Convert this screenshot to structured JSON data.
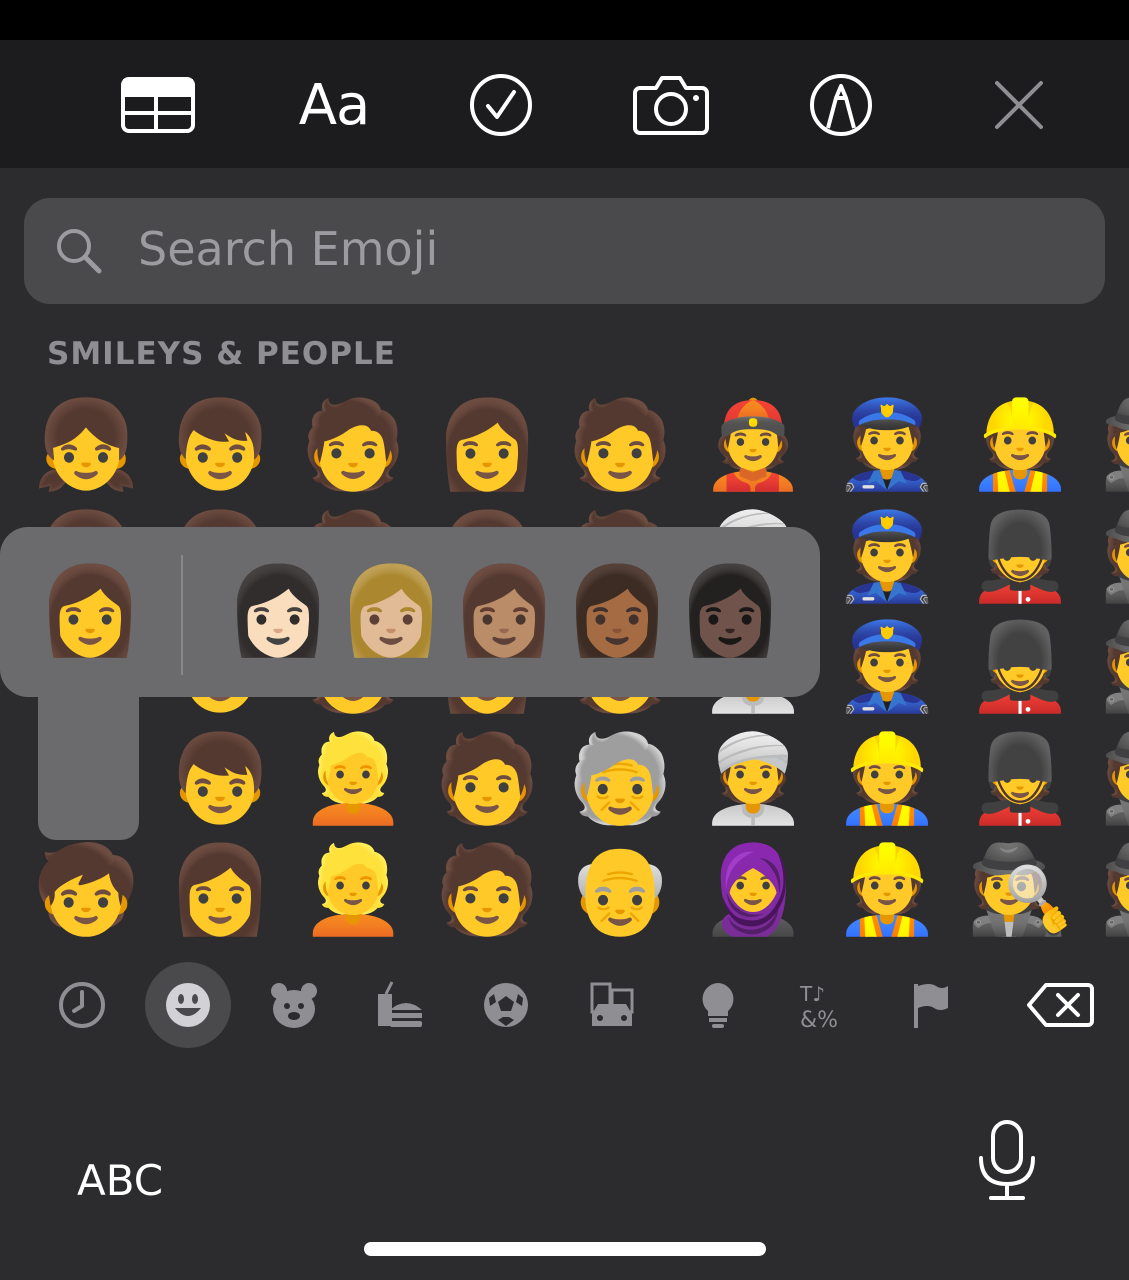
{
  "toolbar": {
    "items": [
      {
        "name": "table-icon"
      },
      {
        "name": "text-format-button",
        "label": "Aa"
      },
      {
        "name": "checklist-icon"
      },
      {
        "name": "camera-icon"
      },
      {
        "name": "markup-pen-icon"
      },
      {
        "name": "close-icon"
      }
    ]
  },
  "search": {
    "placeholder": "Search Emoji"
  },
  "section": {
    "title": "SMILEYS & PEOPLE"
  },
  "grid": {
    "rows": [
      [
        "👧",
        "👦",
        "🧑",
        "👩",
        "🧑",
        "👲",
        "👮",
        "👷",
        "🕵"
      ],
      [
        "👧",
        "👦",
        "🧑",
        "👩",
        "🧑",
        "👳",
        "👮",
        "💂",
        "🕵"
      ],
      [
        "👧",
        "👦",
        "🧑",
        "👩",
        "🧑",
        "👳",
        "👮",
        "💂",
        "🕵"
      ],
      [
        "",
        "👦",
        "👱",
        "🧑",
        "🧓",
        "👳",
        "👷",
        "💂",
        "🕵"
      ],
      [
        "🧒",
        "👩",
        "👱",
        "🧑",
        "👴",
        "🧕",
        "👷",
        "🕵",
        "🕵"
      ]
    ]
  },
  "popup": {
    "base": "👩",
    "variants": [
      "👩🏻",
      "👩🏼",
      "👩🏽",
      "👩🏾",
      "👩🏿"
    ]
  },
  "categories": [
    {
      "name": "recent-icon"
    },
    {
      "name": "smileys-icon",
      "selected": true
    },
    {
      "name": "animals-icon"
    },
    {
      "name": "food-icon"
    },
    {
      "name": "activity-icon"
    },
    {
      "name": "travel-icon"
    },
    {
      "name": "objects-icon"
    },
    {
      "name": "symbols-icon"
    },
    {
      "name": "flags-icon"
    },
    {
      "name": "delete-icon"
    }
  ],
  "bottom": {
    "abc_label": "ABC"
  },
  "colors": {
    "toolbar_bg": "#1c1c1e",
    "keyboard_bg": "#2c2c2e",
    "search_bg": "#4a4a4c",
    "popup_bg": "#6b6b6e"
  }
}
